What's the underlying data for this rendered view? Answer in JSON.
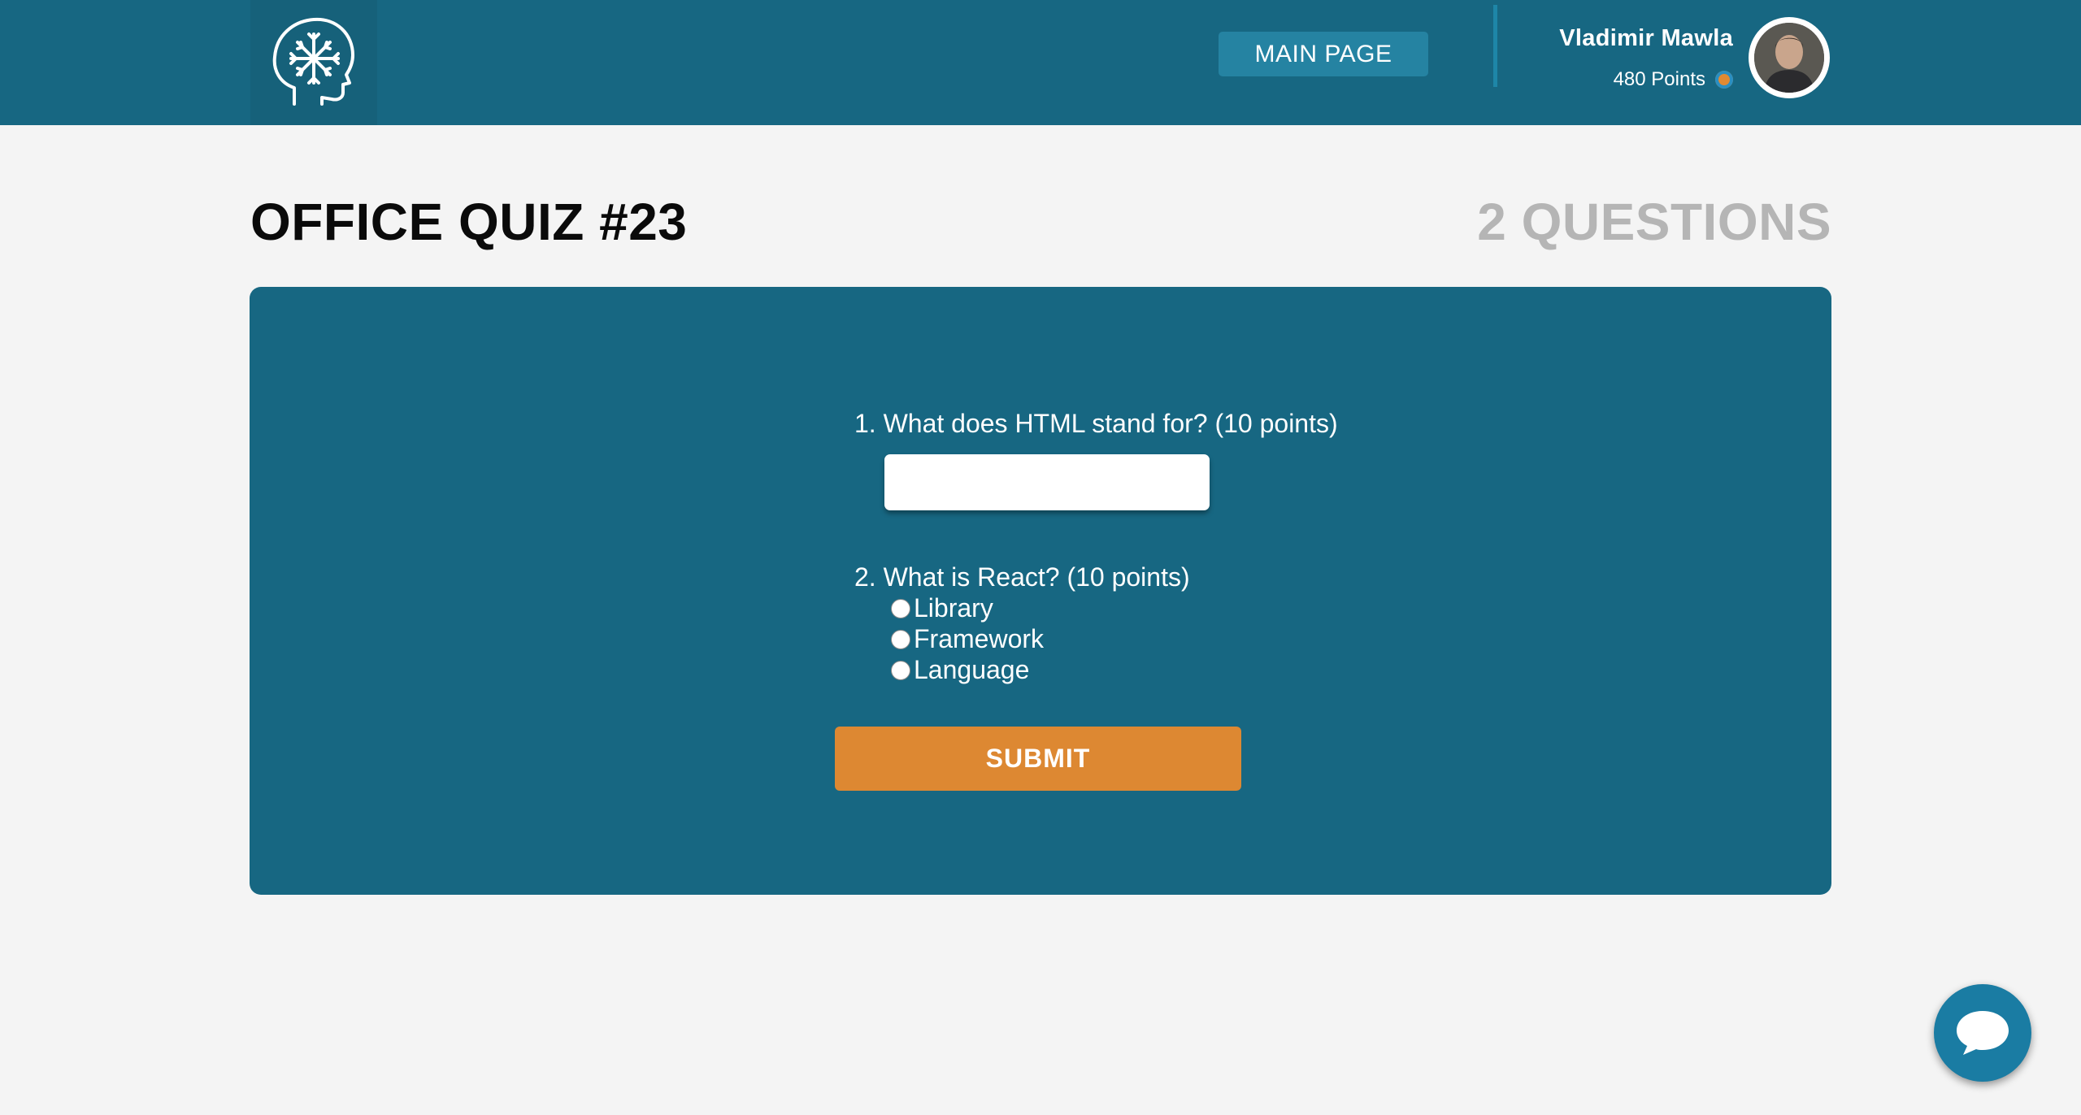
{
  "header": {
    "logo_icon": "brain-head-icon",
    "main_page_label": "MAIN PAGE",
    "user_name": "Vladimir Mawla",
    "points_text": "480 Points",
    "points_icon": "coin-icon"
  },
  "quiz": {
    "title": "OFFICE QUIZ #23",
    "question_count": "2 QUESTIONS",
    "questions": [
      {
        "text": "1. What does HTML stand for? (10 points)",
        "answer_value": "",
        "answer_placeholder": ""
      },
      {
        "text": "2. What is React? (10 points)",
        "options": [
          "Library",
          "Framework",
          "Language"
        ]
      }
    ],
    "submit_label": "SUBMIT"
  },
  "chat": {
    "icon": "chat-bubble-icon"
  },
  "colors": {
    "header_bg": "#176782",
    "card_bg": "#176782",
    "accent_button": "#2583a2",
    "submit_bg": "#dd8832",
    "page_bg": "#f4f4f4"
  }
}
